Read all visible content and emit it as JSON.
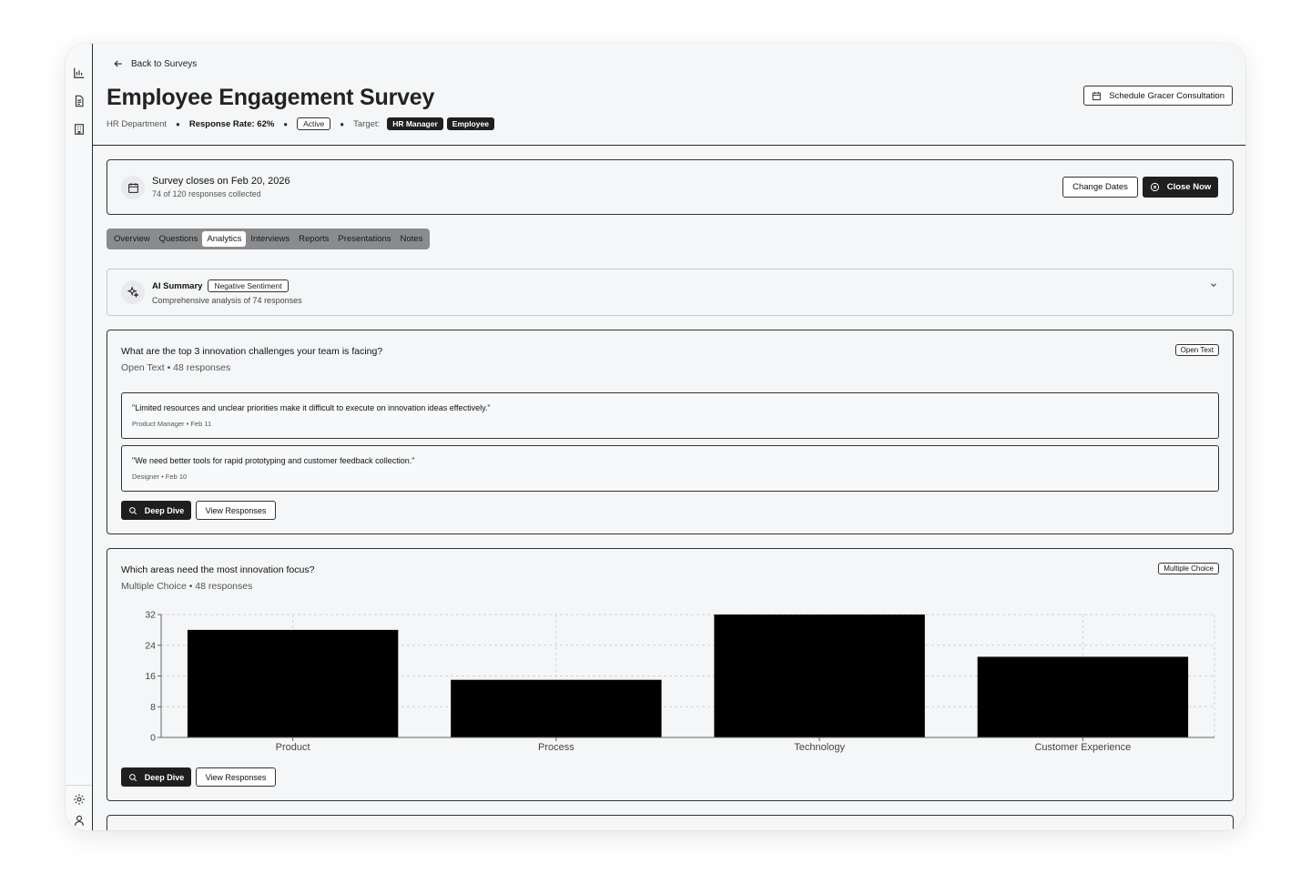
{
  "sidebar": {
    "icons": [
      "bar-chart-icon",
      "document-icon",
      "building-icon",
      "gear-icon",
      "user-icon"
    ]
  },
  "header": {
    "back_label": "Back to Surveys",
    "title": "Employee Engagement Survey",
    "department": "HR Department",
    "response_rate": "Response Rate: 62%",
    "status": "Active",
    "target_label": "Target:",
    "targets": [
      "HR Manager",
      "Employee"
    ],
    "schedule_button": "Schedule Gracer Consultation"
  },
  "closing": {
    "title": "Survey closes on Feb 20, 2026",
    "subtitle": "74 of 120 responses collected",
    "change_dates": "Change Dates",
    "close_now": "Close Now"
  },
  "tabs": [
    {
      "label": "Overview",
      "active": false
    },
    {
      "label": "Questions",
      "active": false
    },
    {
      "label": "Analytics",
      "active": true
    },
    {
      "label": "Interviews",
      "active": false
    },
    {
      "label": "Reports",
      "active": false
    },
    {
      "label": "Presentations",
      "active": false
    },
    {
      "label": "Notes",
      "active": false
    }
  ],
  "ai_summary": {
    "title": "AI Summary",
    "sentiment": "Negative Sentiment",
    "subtitle": "Comprehensive analysis of 74 responses"
  },
  "questions": [
    {
      "title": "What are the top 3 innovation challenges your team is facing?",
      "sub": "Open Text • 48 responses",
      "type": "Open Text",
      "responses": [
        {
          "text": "\"Limited resources and unclear priorities make it difficult to execute on innovation ideas effectively.\"",
          "meta": "Product Manager • Feb 11"
        },
        {
          "text": "\"We need better tools for rapid prototyping and customer feedback collection.\"",
          "meta": "Designer • Feb 10"
        }
      ],
      "deep_dive": "Deep Dive",
      "view_responses": "View Responses"
    },
    {
      "title": "Which areas need the most innovation focus?",
      "sub": "Multiple Choice • 48 responses",
      "type": "Multiple Choice",
      "deep_dive": "Deep Dive",
      "view_responses": "View Responses"
    }
  ],
  "chart_data": {
    "type": "bar",
    "categories": [
      "Product",
      "Process",
      "Technology",
      "Customer Experience"
    ],
    "values": [
      28,
      15,
      32,
      21
    ],
    "yticks": [
      0,
      8,
      16,
      24,
      32
    ],
    "ylim": [
      0,
      32
    ],
    "grid": true,
    "bar_color": "#000000"
  }
}
